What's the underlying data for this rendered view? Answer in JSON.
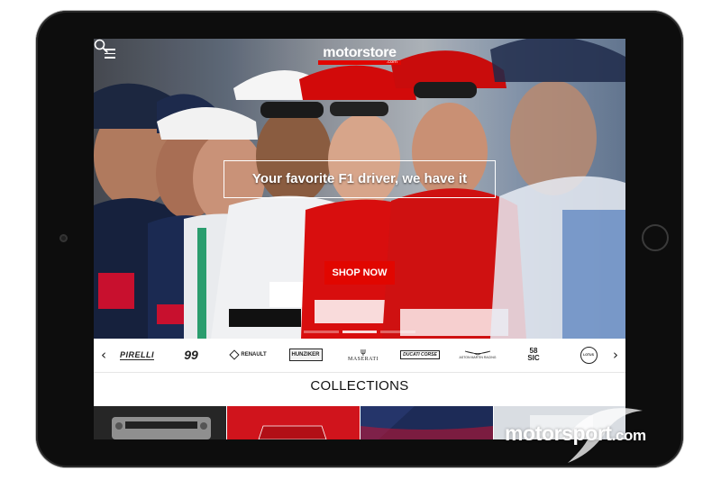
{
  "store": {
    "logo_name": "motorstore",
    "logo_suffix": ".com"
  },
  "hero": {
    "tagline": "Your favorite F1 driver, we have it",
    "cta_label": "SHOP NOW",
    "slide_count": 3,
    "active_slide": 1
  },
  "icons": {
    "menu": "hamburger-menu-icon",
    "search": "search-icon",
    "prev": "chevron-left-icon",
    "next": "chevron-right-icon"
  },
  "brands": {
    "prev_arrow": "‹",
    "next_arrow": "›",
    "items": [
      {
        "name": "PIRELLI"
      },
      {
        "name": "99"
      },
      {
        "name": "RENAULT"
      },
      {
        "name": "HUNZIKER"
      },
      {
        "name": "MASERATI"
      },
      {
        "name": "DUCATI CORSE"
      },
      {
        "name": "ASTON MARTIN RACING"
      },
      {
        "name": "58 SIC"
      },
      {
        "name": "LOTUS"
      }
    ]
  },
  "collections": {
    "title": "COLLECTIONS"
  },
  "watermark": {
    "text": "motorsport",
    "suffix": ".com"
  },
  "colors": {
    "brand_red": "#e10600",
    "tablet_body": "#0d0d0d"
  }
}
